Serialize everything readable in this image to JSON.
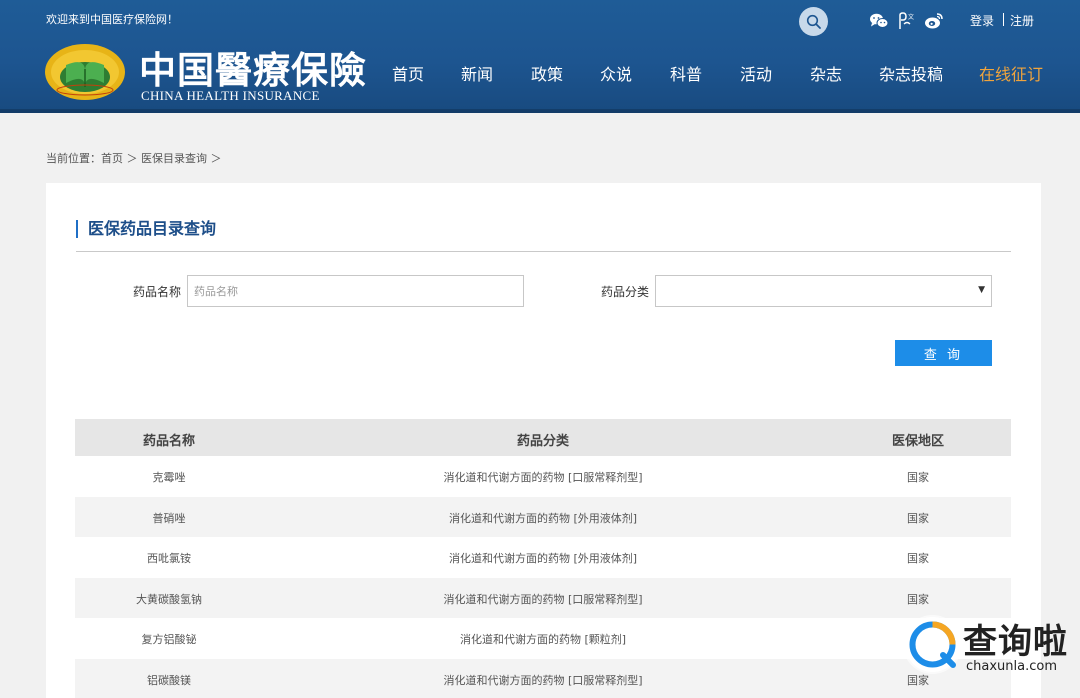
{
  "header": {
    "welcome": "欢迎来到中国医疗保险网！",
    "logo_cn": "中国醫療保險",
    "logo_en": "CHINA HEALTH INSURANCE",
    "login": "登录",
    "register": "注册",
    "social_icons": [
      "wechat-icon",
      "people-icon",
      "weibo-icon"
    ],
    "nav": [
      {
        "label": "首页"
      },
      {
        "label": "新闻"
      },
      {
        "label": "政策"
      },
      {
        "label": "众说"
      },
      {
        "label": "科普"
      },
      {
        "label": "活动"
      },
      {
        "label": "杂志"
      },
      {
        "label": "杂志投稿"
      },
      {
        "label": "在线征订"
      }
    ],
    "colors": {
      "bg": "#1d5590",
      "highlight": "#f0a43d"
    }
  },
  "breadcrumb": "当前位置：首页 ＞ 医保目录查询 ＞",
  "main": {
    "title": "医保药品目录查询",
    "form": {
      "name_label": "药品名称",
      "name_placeholder": "药品名称",
      "category_label": "药品分类",
      "category_value": "",
      "query_button": "查 询"
    },
    "table": {
      "headers": [
        "药品名称",
        "药品分类",
        "医保地区"
      ],
      "rows": [
        {
          "name": "克霉唑",
          "category": "消化道和代谢方面的药物 [口服常释剂型]",
          "region": "国家"
        },
        {
          "name": "普硝唑",
          "category": "消化道和代谢方面的药物 [外用液体剂]",
          "region": "国家"
        },
        {
          "name": "西吡氯铵",
          "category": "消化道和代谢方面的药物 [外用液体剂]",
          "region": "国家"
        },
        {
          "name": "大黄碳酸氢钠",
          "category": "消化道和代谢方面的药物 [口服常释剂型]",
          "region": "国家"
        },
        {
          "name": "复方铝酸铋",
          "category": "消化道和代谢方面的药物 [颗粒剂]",
          "region": ""
        },
        {
          "name": "铝碳酸镁",
          "category": "消化道和代谢方面的药物 [口服常释剂型]",
          "region": "国家"
        }
      ]
    },
    "colors": {
      "accent": "#1d8de8",
      "title": "#1d4e89"
    }
  },
  "watermark": {
    "text": "查询啦",
    "url": "chaxunla.com"
  }
}
